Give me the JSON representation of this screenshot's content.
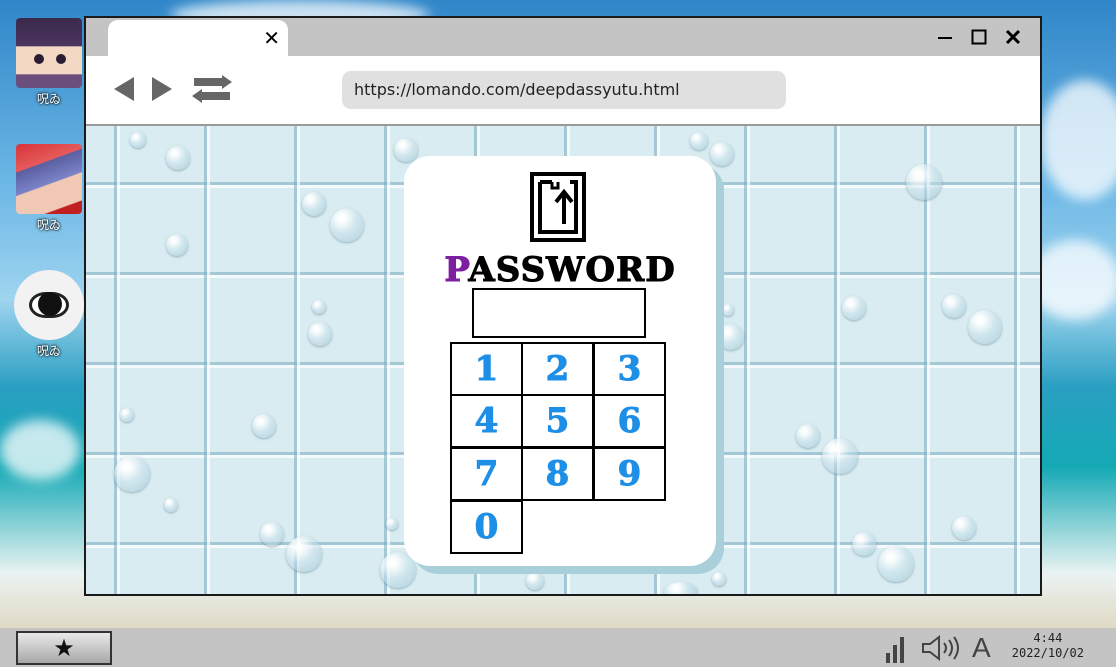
{
  "desktop": {
    "icons": [
      {
        "name": "girl-portrait-1",
        "label": "呪ゐ"
      },
      {
        "name": "girl-portrait-2",
        "label": "呪ゐ"
      },
      {
        "name": "eye-image",
        "label": "呪ゐ"
      }
    ]
  },
  "browser": {
    "tab": {
      "close_icon": "close-icon",
      "close_glyph": "✕"
    },
    "window_controls": [
      "minimize-icon",
      "maximize-icon",
      "close-icon"
    ],
    "nav": [
      "back-arrow-icon",
      "forward-arrow-icon",
      "reload-icon"
    ],
    "url": "https://lomando.com/deepdassyutu.html"
  },
  "page": {
    "icon": "document-upload-icon",
    "title_first_letter": "P",
    "title_rest": "ASSWORD",
    "password_value": "",
    "keys": [
      "1",
      "2",
      "3",
      "4",
      "5",
      "6",
      "7",
      "8",
      "9",
      "0"
    ],
    "colors": {
      "title_accent": "#7d1fa0",
      "key_digits": "#1e8fe6",
      "card_shadow": "#a9d0da"
    }
  },
  "taskbar": {
    "start_icon": "star-icon",
    "start_glyph": "★",
    "tray": [
      "signal-icon",
      "speaker-icon"
    ],
    "ime": "A",
    "time": "4:44",
    "date": "2022/10/02"
  }
}
